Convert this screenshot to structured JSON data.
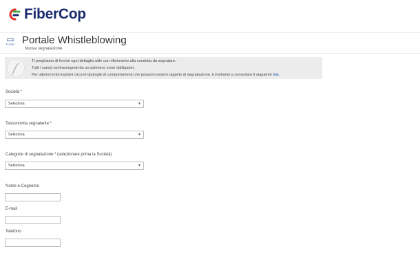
{
  "brand": {
    "name": "FiberCop"
  },
  "header": {
    "icon_label": "Portale",
    "title": "Portale Whistleblowing",
    "subtitle": "Nuova segnalazione"
  },
  "info": {
    "line1": "Ti preghiamo di fornire ogni dettaglio utile con riferimento alla condotta da segnalare.",
    "line2": "Tutti i campi contrassegnati da un asterisco sono obbligatori.",
    "line3": "Per ulteriori informazioni circa le tipologie di comportamenti che possono essere oggetto di segnalazione, ti invitiamo a consultare il seguente",
    "link": "link."
  },
  "form": {
    "societa": {
      "label": "Società *",
      "value": "Seleziona"
    },
    "tassonomia": {
      "label": "Tassonomia segnalante *",
      "value": "Seleziona"
    },
    "categorie": {
      "label": "Categorie di segnalazione * (selezionare prima la Società)",
      "value": "Seleziona"
    },
    "nome": {
      "label": "Nome e Cognome",
      "value": ""
    },
    "email": {
      "label": "E-mail",
      "value": ""
    },
    "telefono": {
      "label": "Telefono",
      "value": ""
    }
  },
  "colors": {
    "brand_blue": "#1a2b6e",
    "brand_red": "#e03a2f",
    "brand_green": "#4bae4f",
    "link_blue": "#1a4fb5",
    "info_bg": "#ececec"
  }
}
